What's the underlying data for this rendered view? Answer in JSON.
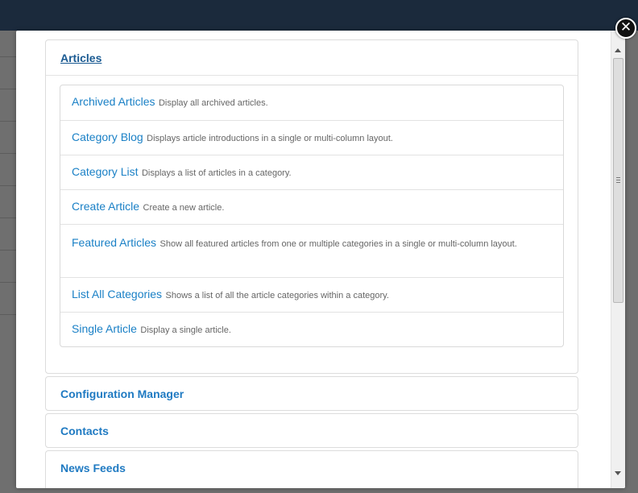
{
  "close_glyph": "✕",
  "sections": [
    {
      "title": "Articles",
      "expanded": true,
      "items": [
        {
          "title": "Archived Articles",
          "desc": "Display all archived articles."
        },
        {
          "title": "Category Blog",
          "desc": "Displays article introductions in a single or multi-column layout."
        },
        {
          "title": "Category List",
          "desc": "Displays a list of articles in a category."
        },
        {
          "title": "Create Article",
          "desc": "Create a new article."
        },
        {
          "title": "Featured Articles",
          "desc": "Show all featured articles from one or multiple categories in a single or multi-column layout."
        },
        {
          "title": "List All Categories",
          "desc": "Shows a list of all the article categories within a category."
        },
        {
          "title": "Single Article",
          "desc": "Display a single article."
        }
      ]
    },
    {
      "title": "Configuration Manager",
      "expanded": false
    },
    {
      "title": "Contacts",
      "expanded": false
    },
    {
      "title": "News Feeds",
      "expanded": false
    }
  ],
  "colors": {
    "link": "#1a80c6",
    "section_link": "#1f7ac2",
    "top_bar": "#1b2a3c",
    "overlay": "#6f6f6f"
  }
}
